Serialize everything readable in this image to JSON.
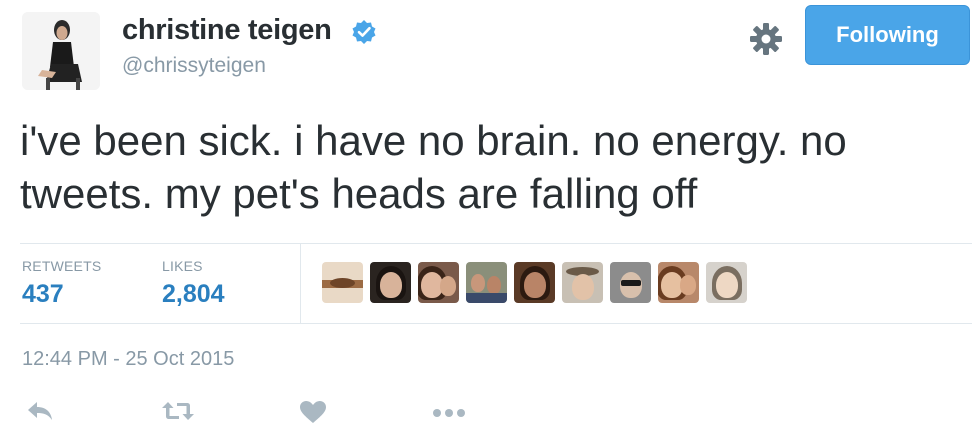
{
  "user": {
    "name": "christine teigen",
    "handle": "@chrissyteigen",
    "verified": true,
    "avatar_icon": "profile-photo"
  },
  "header": {
    "follow_label": "Following",
    "gear_icon": "gear-icon"
  },
  "tweet": {
    "text": "i've been sick. i have no brain. no energy. no tweets. my pet's heads are falling off",
    "timestamp": "12:44 PM - 25 Oct 2015"
  },
  "stats": {
    "retweets_label": "RETWEETS",
    "retweets_value": "437",
    "likes_label": "LIKES",
    "likes_value": "2,804"
  },
  "likers": [
    {
      "name": "liker-1"
    },
    {
      "name": "liker-2"
    },
    {
      "name": "liker-3"
    },
    {
      "name": "liker-4"
    },
    {
      "name": "liker-5"
    },
    {
      "name": "liker-6"
    },
    {
      "name": "liker-7"
    },
    {
      "name": "liker-8"
    },
    {
      "name": "liker-9"
    }
  ],
  "actions": [
    "reply-icon",
    "retweet-icon",
    "like-icon",
    "more-icon"
  ],
  "colors": {
    "accent": "#4aa5e8",
    "link": "#2a7fbf",
    "muted": "#8899a6",
    "verified": "#4aa5e8",
    "text": "#292f33"
  }
}
